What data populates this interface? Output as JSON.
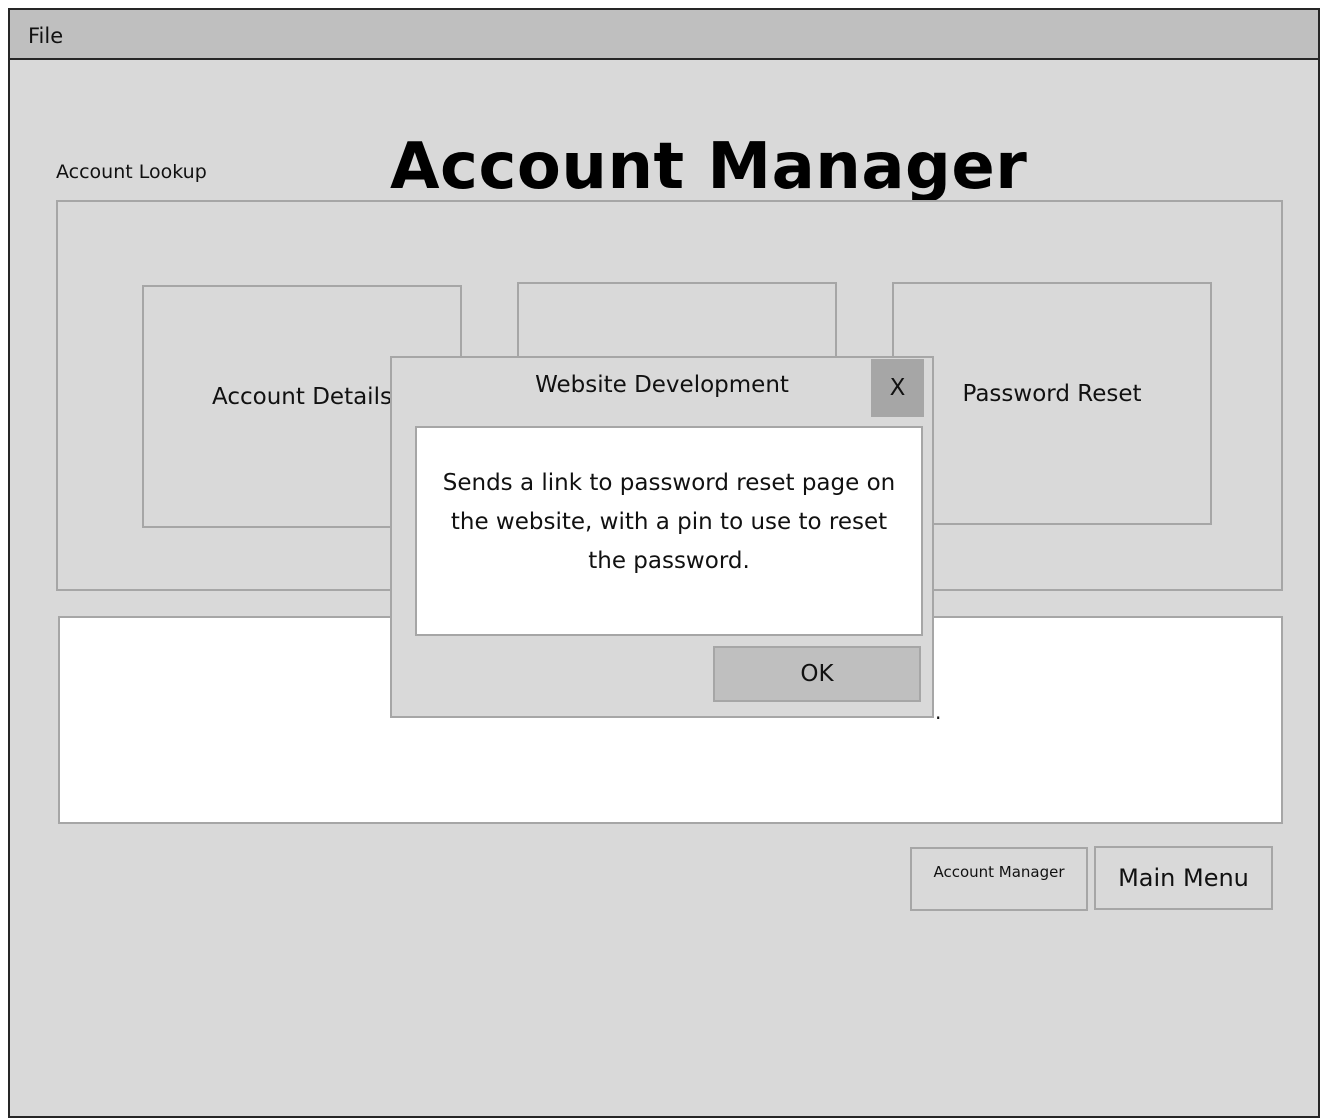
{
  "menubar": {
    "file_label": "File"
  },
  "page": {
    "section_label": "Account Lookup",
    "title": "Account Manager"
  },
  "cards": [
    {
      "label": "Account Details"
    },
    {
      "label": ""
    },
    {
      "label": "Password Reset"
    }
  ],
  "output": {
    "text": "."
  },
  "footer": {
    "account_manager_label": "Account Manager",
    "main_menu_label": "Main Menu"
  },
  "dialog": {
    "title": "Website Development",
    "close_label": "X",
    "message": "Sends a link to password reset page on the website, with a pin to use to reset the password.",
    "ok_label": "OK"
  }
}
